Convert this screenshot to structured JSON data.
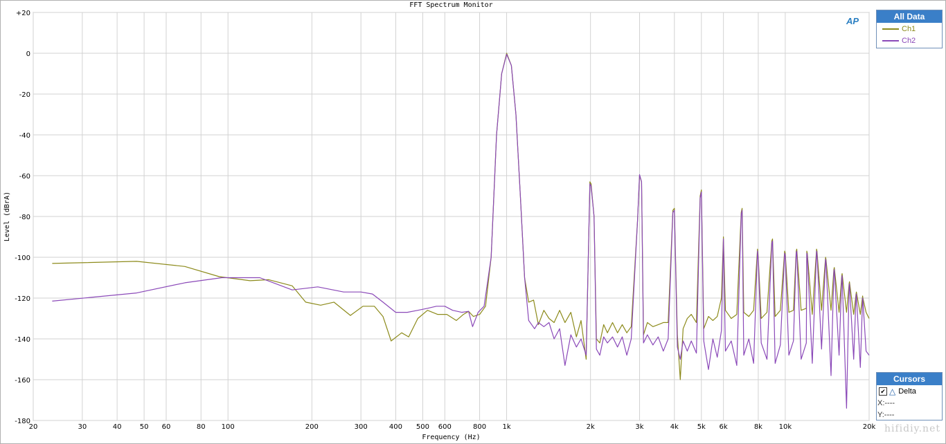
{
  "window": {
    "title": "FFT Spectrum Monitor"
  },
  "logo": "AP",
  "watermark": "hifidiy.net",
  "legend": {
    "header": "All Data",
    "items": [
      {
        "label": "Ch1",
        "color": "#8c8a1a"
      },
      {
        "label": "Ch2",
        "color": "#8a48b8"
      }
    ]
  },
  "cursors": {
    "header": "Cursors",
    "delta_label": "Delta",
    "delta_checked": true,
    "x_readout": "X:----",
    "y_readout": "Y:----"
  },
  "chart_data": {
    "type": "line",
    "title": "FFT Spectrum Monitor",
    "xlabel": "Frequency (Hz)",
    "ylabel": "Level (dBrA)",
    "xscale": "log",
    "xlim": [
      20,
      20000
    ],
    "ylim": [
      -180,
      20
    ],
    "x_ticks": [
      20,
      30,
      40,
      50,
      60,
      80,
      100,
      200,
      300,
      400,
      500,
      600,
      800,
      1000,
      2000,
      3000,
      4000,
      5000,
      6000,
      8000,
      10000,
      20000
    ],
    "x_tick_labels": [
      "20",
      "30",
      "40",
      "50",
      "60",
      "80",
      "100",
      "200",
      "300",
      "400",
      "500",
      "600",
      "800",
      "1k",
      "2k",
      "3k",
      "4k",
      "5k",
      "6k",
      "8k",
      "10k",
      "20k"
    ],
    "y_ticks": [
      20,
      0,
      -20,
      -40,
      -60,
      -80,
      -100,
      -120,
      -140,
      -160,
      -180
    ],
    "y_tick_labels": [
      "+20",
      "0",
      "-20",
      "-40",
      "-60",
      "-80",
      "-100",
      "-120",
      "-140",
      "-160",
      "-180"
    ],
    "grid": true,
    "legend_position": "top-right",
    "series": [
      {
        "name": "Ch1",
        "color": "#8c8a1a",
        "points": [
          [
            23.4,
            -103
          ],
          [
            47,
            -102
          ],
          [
            70,
            -104.5
          ],
          [
            93,
            -109.5
          ],
          [
            120,
            -111.5
          ],
          [
            140,
            -111
          ],
          [
            170,
            -114
          ],
          [
            190,
            -122
          ],
          [
            215,
            -123.5
          ],
          [
            240,
            -122
          ],
          [
            275,
            -128.5
          ],
          [
            305,
            -124
          ],
          [
            335,
            -124
          ],
          [
            360,
            -129
          ],
          [
            385,
            -141
          ],
          [
            420,
            -137
          ],
          [
            445,
            -139
          ],
          [
            480,
            -130
          ],
          [
            520,
            -126
          ],
          [
            565,
            -128
          ],
          [
            610,
            -128
          ],
          [
            660,
            -131
          ],
          [
            700,
            -128
          ],
          [
            730,
            -126.5
          ],
          [
            760,
            -129
          ],
          [
            800,
            -128
          ],
          [
            840,
            -124
          ],
          [
            880,
            -100
          ],
          [
            920,
            -40
          ],
          [
            960,
            -10
          ],
          [
            1000,
            0
          ],
          [
            1040,
            -6
          ],
          [
            1080,
            -30
          ],
          [
            1120,
            -70
          ],
          [
            1160,
            -110
          ],
          [
            1200,
            -122
          ],
          [
            1250,
            -121
          ],
          [
            1300,
            -133
          ],
          [
            1360,
            -126
          ],
          [
            1420,
            -130
          ],
          [
            1480,
            -132
          ],
          [
            1550,
            -126
          ],
          [
            1620,
            -132
          ],
          [
            1700,
            -127
          ],
          [
            1780,
            -139
          ],
          [
            1850,
            -131
          ],
          [
            1930,
            -150
          ],
          [
            1990,
            -63
          ],
          [
            2010,
            -64
          ],
          [
            2060,
            -80
          ],
          [
            2100,
            -140
          ],
          [
            2160,
            -142
          ],
          [
            2230,
            -133
          ],
          [
            2300,
            -137
          ],
          [
            2400,
            -132
          ],
          [
            2500,
            -137
          ],
          [
            2600,
            -133
          ],
          [
            2700,
            -137
          ],
          [
            2800,
            -134
          ],
          [
            2950,
            -82
          ],
          [
            3000,
            -60
          ],
          [
            3050,
            -63
          ],
          [
            3100,
            -138
          ],
          [
            3200,
            -132
          ],
          [
            3350,
            -134
          ],
          [
            3500,
            -133
          ],
          [
            3650,
            -132
          ],
          [
            3800,
            -132
          ],
          [
            3950,
            -77
          ],
          [
            4000,
            -76
          ],
          [
            4100,
            -138
          ],
          [
            4200,
            -160
          ],
          [
            4300,
            -135
          ],
          [
            4450,
            -130
          ],
          [
            4600,
            -128
          ],
          [
            4800,
            -132
          ],
          [
            4950,
            -70
          ],
          [
            5000,
            -67
          ],
          [
            5100,
            -135
          ],
          [
            5300,
            -129
          ],
          [
            5500,
            -131
          ],
          [
            5700,
            -129
          ],
          [
            5900,
            -120
          ],
          [
            6000,
            -90
          ],
          [
            6100,
            -126
          ],
          [
            6400,
            -130
          ],
          [
            6700,
            -128
          ],
          [
            6950,
            -78
          ],
          [
            7000,
            -76
          ],
          [
            7100,
            -127
          ],
          [
            7400,
            -129
          ],
          [
            7700,
            -126
          ],
          [
            7950,
            -96
          ],
          [
            8000,
            -100
          ],
          [
            8200,
            -130
          ],
          [
            8600,
            -127
          ],
          [
            8950,
            -92
          ],
          [
            9000,
            -91
          ],
          [
            9200,
            -129
          ],
          [
            9600,
            -126
          ],
          [
            9950,
            -97
          ],
          [
            10000,
            -98
          ],
          [
            10300,
            -127
          ],
          [
            10700,
            -126
          ],
          [
            10950,
            -97
          ],
          [
            11000,
            -96
          ],
          [
            11400,
            -126
          ],
          [
            11900,
            -125
          ],
          [
            11950,
            -97
          ],
          [
            12000,
            -98
          ],
          [
            12500,
            -128
          ],
          [
            12950,
            -96
          ],
          [
            13000,
            -97
          ],
          [
            13500,
            -126
          ],
          [
            13950,
            -100
          ],
          [
            14000,
            -101
          ],
          [
            14600,
            -126
          ],
          [
            14950,
            -106
          ],
          [
            15000,
            -105
          ],
          [
            15600,
            -127
          ],
          [
            15950,
            -109
          ],
          [
            16000,
            -108
          ],
          [
            16600,
            -127
          ],
          [
            16950,
            -113
          ],
          [
            17000,
            -112
          ],
          [
            17600,
            -128
          ],
          [
            17950,
            -118
          ],
          [
            18000,
            -117
          ],
          [
            18600,
            -128
          ],
          [
            18950,
            -119
          ],
          [
            19000,
            -120
          ],
          [
            19500,
            -127
          ],
          [
            20000,
            -130
          ]
        ]
      },
      {
        "name": "Ch2",
        "color": "#8a48b8",
        "points": [
          [
            23.4,
            -121.5
          ],
          [
            47,
            -117.5
          ],
          [
            70,
            -112.5
          ],
          [
            95,
            -110
          ],
          [
            130,
            -110
          ],
          [
            170,
            -116
          ],
          [
            210,
            -114.5
          ],
          [
            260,
            -117
          ],
          [
            300,
            -117
          ],
          [
            330,
            -118
          ],
          [
            360,
            -122
          ],
          [
            400,
            -127
          ],
          [
            440,
            -127
          ],
          [
            480,
            -126
          ],
          [
            520,
            -125
          ],
          [
            560,
            -124
          ],
          [
            600,
            -124
          ],
          [
            640,
            -126
          ],
          [
            690,
            -127
          ],
          [
            730,
            -126.5
          ],
          [
            755,
            -134
          ],
          [
            790,
            -127
          ],
          [
            830,
            -124
          ],
          [
            880,
            -100
          ],
          [
            920,
            -40
          ],
          [
            960,
            -10
          ],
          [
            1000,
            -0.5
          ],
          [
            1040,
            -6
          ],
          [
            1080,
            -30
          ],
          [
            1120,
            -70
          ],
          [
            1160,
            -110
          ],
          [
            1200,
            -131
          ],
          [
            1260,
            -135
          ],
          [
            1300,
            -132
          ],
          [
            1360,
            -134
          ],
          [
            1420,
            -132
          ],
          [
            1480,
            -140
          ],
          [
            1550,
            -135
          ],
          [
            1620,
            -153
          ],
          [
            1700,
            -138
          ],
          [
            1780,
            -144
          ],
          [
            1850,
            -140
          ],
          [
            1930,
            -148
          ],
          [
            1990,
            -64
          ],
          [
            2010,
            -65
          ],
          [
            2060,
            -80
          ],
          [
            2100,
            -145
          ],
          [
            2160,
            -148
          ],
          [
            2230,
            -139
          ],
          [
            2300,
            -142
          ],
          [
            2400,
            -139
          ],
          [
            2500,
            -144
          ],
          [
            2600,
            -139
          ],
          [
            2700,
            -148
          ],
          [
            2800,
            -140
          ],
          [
            2950,
            -82
          ],
          [
            3000,
            -59.5
          ],
          [
            3050,
            -63
          ],
          [
            3100,
            -142
          ],
          [
            3200,
            -138
          ],
          [
            3350,
            -143
          ],
          [
            3500,
            -139
          ],
          [
            3650,
            -146
          ],
          [
            3800,
            -140
          ],
          [
            3950,
            -78
          ],
          [
            4000,
            -77
          ],
          [
            4100,
            -144
          ],
          [
            4200,
            -150
          ],
          [
            4300,
            -141
          ],
          [
            4450,
            -146
          ],
          [
            4600,
            -141
          ],
          [
            4800,
            -147
          ],
          [
            4950,
            -71
          ],
          [
            5000,
            -68
          ],
          [
            5100,
            -141
          ],
          [
            5300,
            -155
          ],
          [
            5500,
            -140
          ],
          [
            5700,
            -149
          ],
          [
            5900,
            -136
          ],
          [
            6000,
            -91
          ],
          [
            6100,
            -146
          ],
          [
            6400,
            -141
          ],
          [
            6700,
            -153
          ],
          [
            6950,
            -79
          ],
          [
            7000,
            -77
          ],
          [
            7100,
            -148
          ],
          [
            7400,
            -140
          ],
          [
            7700,
            -152
          ],
          [
            7950,
            -97
          ],
          [
            8000,
            -101
          ],
          [
            8200,
            -142
          ],
          [
            8600,
            -150
          ],
          [
            8950,
            -93
          ],
          [
            9000,
            -92
          ],
          [
            9200,
            -152
          ],
          [
            9600,
            -143
          ],
          [
            9950,
            -98
          ],
          [
            10000,
            -99
          ],
          [
            10300,
            -148
          ],
          [
            10700,
            -141
          ],
          [
            10950,
            -98
          ],
          [
            11000,
            -97
          ],
          [
            11400,
            -150
          ],
          [
            11900,
            -142
          ],
          [
            11950,
            -98
          ],
          [
            12000,
            -99
          ],
          [
            12500,
            -152
          ],
          [
            12950,
            -97
          ],
          [
            13000,
            -98
          ],
          [
            13500,
            -145
          ],
          [
            13950,
            -101
          ],
          [
            14000,
            -102
          ],
          [
            14600,
            -158
          ],
          [
            14950,
            -107
          ],
          [
            15000,
            -106
          ],
          [
            15600,
            -148
          ],
          [
            15950,
            -110
          ],
          [
            16000,
            -109
          ],
          [
            16600,
            -174
          ],
          [
            16950,
            -114
          ],
          [
            17000,
            -113
          ],
          [
            17600,
            -150
          ],
          [
            17950,
            -119
          ],
          [
            18000,
            -118
          ],
          [
            18600,
            -154
          ],
          [
            18950,
            -120
          ],
          [
            19000,
            -121
          ],
          [
            19500,
            -146
          ],
          [
            20000,
            -148
          ]
        ]
      }
    ]
  }
}
